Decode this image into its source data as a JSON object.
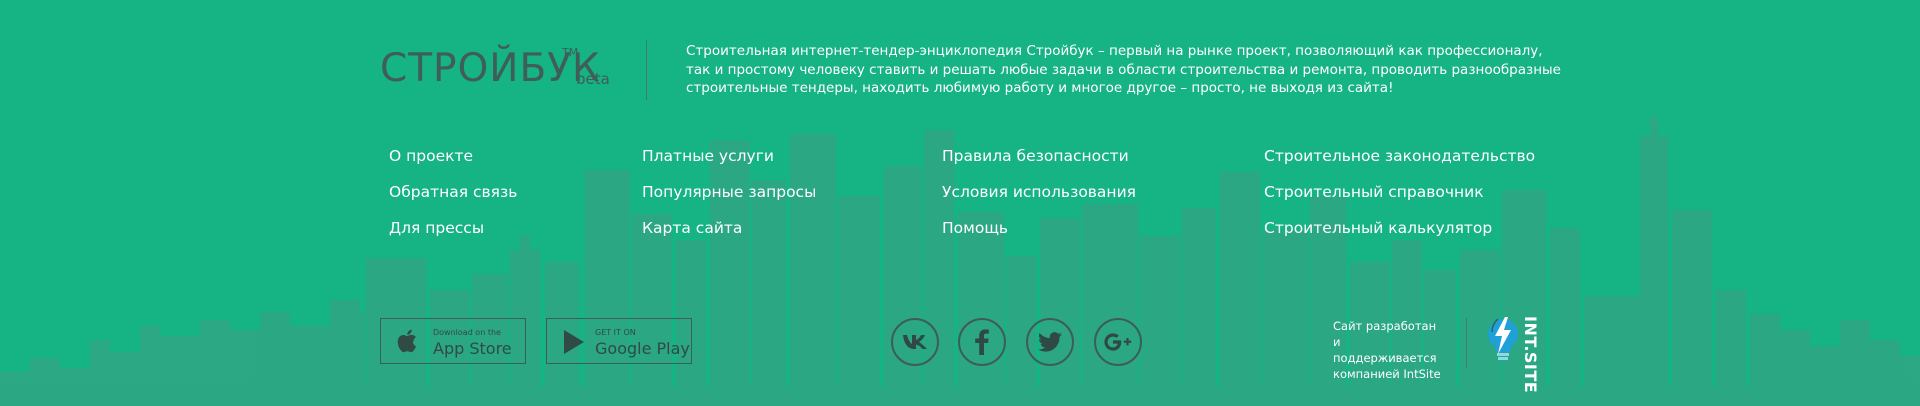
{
  "brand": {
    "name": "СТРОЙБУК",
    "trademark": "TM",
    "badge": "beta",
    "description": "Строительная интернет-тендер-энциклопедия Стройбук – первый на рынке проект, позволяющий как профессионалу, так и простому человеку ставить и решать любые задачи в области строительства и ремонта, проводить разнообразные строительные тендеры, находить любимую работу и многое другое – просто, не выходя из сайта!"
  },
  "nav": {
    "col1": [
      "О проекте",
      "Обратная связь",
      "Для прессы"
    ],
    "col2": [
      "Платные услуги",
      "Популярные запросы",
      "Карта сайта"
    ],
    "col3": [
      "Правила безопасности",
      "Условия использования",
      "Помощь"
    ],
    "col4": [
      "Строительное законодательство",
      "Строительный справочник",
      "Строительный калькулятор"
    ]
  },
  "stores": {
    "appstore": {
      "small": "Download on the",
      "big": "App Store",
      "icon": "apple-icon"
    },
    "googleplay": {
      "small": "GET IT ON",
      "big": "Google Play",
      "icon": "play-icon"
    }
  },
  "social": {
    "vk": {
      "label": "vk",
      "icon": "vk-icon"
    },
    "facebook": {
      "label": "f",
      "icon": "facebook-icon"
    },
    "twitter": {
      "label": "twitter",
      "icon": "twitter-icon"
    },
    "googleplus": {
      "label": "G+",
      "icon": "google-plus-icon"
    }
  },
  "developer": {
    "line1": "Сайт разработан",
    "line2": "и поддерживается",
    "line3": "компанией IntSite",
    "logo_text": "INT.SITE"
  },
  "colors": {
    "background": "#16b384",
    "skyline": "#2fa684",
    "dark_text": "#3f5e57",
    "link": "#ffffff"
  }
}
